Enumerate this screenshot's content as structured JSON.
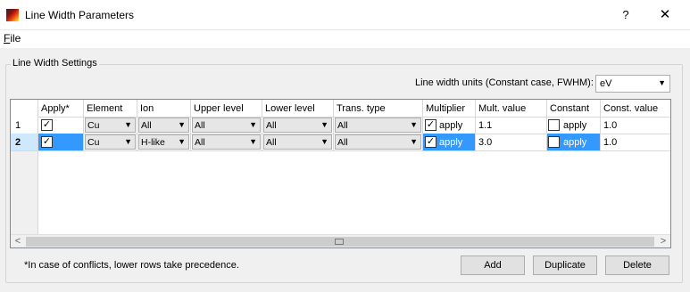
{
  "window": {
    "title": "Line Width Parameters",
    "help_glyph": "?",
    "close_glyph": "✕"
  },
  "menu": {
    "file_mnemonic": "F",
    "file_rest": "ile"
  },
  "group": {
    "title": "Line Width Settings",
    "units_label": "Line width units (Constant case, FWHM):",
    "units_value": "eV"
  },
  "table": {
    "columns": [
      "Apply*",
      "Element",
      "Ion",
      "Upper level",
      "Lower level",
      "Trans. type",
      "Multiplier",
      "Mult. value",
      "Constant",
      "Const. value"
    ],
    "rows": [
      {
        "number": "1",
        "apply_checked": true,
        "element": "Cu",
        "ion": "All",
        "upper_level": "All",
        "lower_level": "All",
        "trans_type": "All",
        "multiplier_checked": true,
        "multiplier_label": "apply",
        "mult_value": "1.1",
        "constant_checked": false,
        "constant_label": "apply",
        "const_value": "1.0"
      },
      {
        "number": "2",
        "apply_checked": true,
        "element": "Cu",
        "ion": "H-like",
        "upper_level": "All",
        "lower_level": "All",
        "trans_type": "All",
        "multiplier_checked": true,
        "multiplier_label": "apply",
        "mult_value": "3.0",
        "constant_checked": false,
        "constant_label": "apply",
        "const_value": "1.0"
      }
    ],
    "selected_row_number": "2"
  },
  "footer": {
    "note": "*In case of conflicts, lower rows take precedence.",
    "add_label": "Add",
    "duplicate_label": "Duplicate",
    "delete_label": "Delete"
  },
  "colors": {
    "selection": "#3399ff",
    "row_header_selected": "#cde8ff"
  },
  "icons": {
    "app": "spectrum-gradient-icon",
    "help": "help-icon",
    "close": "close-icon",
    "dropdown": "chevron-down-icon",
    "checkmark": "check-icon"
  }
}
